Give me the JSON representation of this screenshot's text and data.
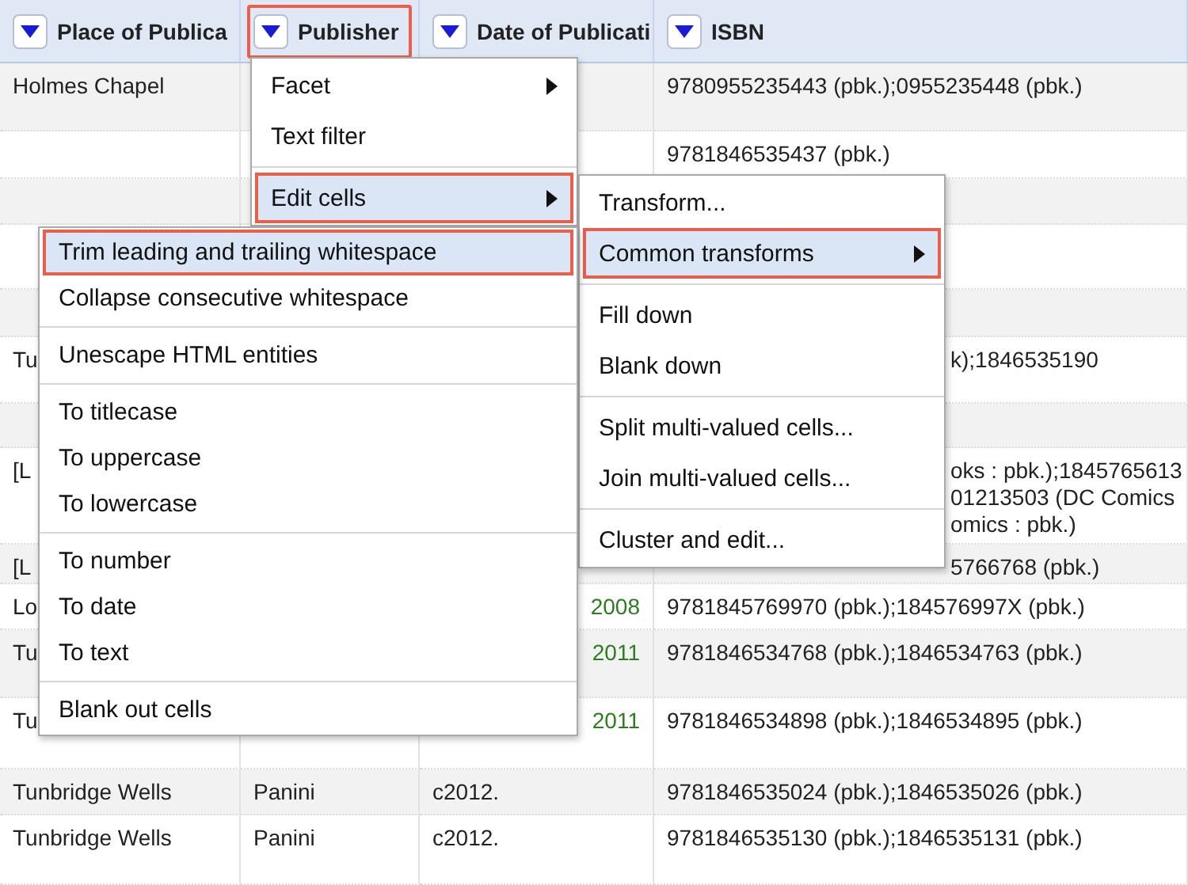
{
  "columns": [
    {
      "label": "Place of Publica",
      "outlined": false
    },
    {
      "label": "Publisher",
      "outlined": true
    },
    {
      "label": "Date of Publicati",
      "outlined": false
    },
    {
      "label": "ISBN",
      "outlined": false
    }
  ],
  "rows": [
    {
      "place": {
        "kind": "text",
        "text": "Holmes Chapel"
      },
      "isbn": {
        "kind": "text",
        "text": "9780955235443 (pbk.);0955235448 (pbk.)"
      }
    },
    {
      "isbn": {
        "kind": "text",
        "text": "9781846535437 (pbk.)"
      }
    },
    {},
    {},
    {},
    {
      "place": {
        "kind": "text",
        "text": "Tu"
      },
      "isbn": {
        "kind": "clipped",
        "text": "k);1846535190"
      }
    },
    {},
    {
      "place": {
        "kind": "text",
        "text": "[L"
      },
      "isbn": {
        "kind": "clipped",
        "text": "oks : pbk.);1845765613\n01213503 (DC Comics\nomics : pbk.)"
      }
    },
    {
      "place": {
        "kind": "text",
        "text": "[L"
      },
      "isbn": {
        "kind": "clipped",
        "text": "5766768 (pbk.)"
      }
    },
    {
      "place": {
        "kind": "text",
        "text": "Lo"
      },
      "date": {
        "kind": "number",
        "text": "2008"
      },
      "isbn": {
        "kind": "text",
        "text": "9781845769970 (pbk.);184576997X (pbk.)"
      }
    },
    {
      "place": {
        "kind": "text",
        "text": "Tu"
      },
      "date": {
        "kind": "number",
        "text": "2011"
      },
      "isbn": {
        "kind": "text",
        "text": "9781846534768 (pbk.);1846534763 (pbk.)"
      }
    },
    {
      "place": {
        "kind": "text",
        "text": "Tu"
      },
      "date": {
        "kind": "number",
        "text": "2011"
      },
      "isbn": {
        "kind": "text",
        "text": "9781846534898 (pbk.);1846534895 (pbk.)"
      }
    },
    {
      "place": {
        "kind": "text",
        "text": "Tunbridge Wells"
      },
      "publisher": {
        "kind": "text",
        "text": "Panini"
      },
      "date": {
        "kind": "text",
        "text": "c2012."
      },
      "isbn": {
        "kind": "text",
        "text": "9781846535024 (pbk.);1846535026 (pbk.)"
      }
    },
    {
      "place": {
        "kind": "text",
        "text": "Tunbridge Wells"
      },
      "publisher": {
        "kind": "text",
        "text": "Panini"
      },
      "date": {
        "kind": "text",
        "text": "c2012."
      },
      "isbn": {
        "kind": "text",
        "text": "9781846535130 (pbk.);1846535131 (pbk.)"
      }
    }
  ],
  "menus": [
    {
      "items": [
        {
          "kind": "item",
          "label": "Facet",
          "submenu": true,
          "selected": false,
          "outlined": false
        },
        {
          "kind": "item",
          "label": "Text filter",
          "submenu": false,
          "selected": false,
          "outlined": false
        },
        {
          "kind": "separator"
        },
        {
          "kind": "item",
          "label": "Edit cells",
          "submenu": true,
          "selected": true,
          "outlined": true
        }
      ]
    },
    {
      "items": [
        {
          "kind": "item",
          "label": "Transform...",
          "submenu": false,
          "selected": false,
          "outlined": false
        },
        {
          "kind": "item",
          "label": "Common transforms",
          "submenu": true,
          "selected": true,
          "outlined": true
        },
        {
          "kind": "separator"
        },
        {
          "kind": "item",
          "label": "Fill down",
          "submenu": false,
          "selected": false,
          "outlined": false
        },
        {
          "kind": "item",
          "label": "Blank down",
          "submenu": false,
          "selected": false,
          "outlined": false
        },
        {
          "kind": "separator"
        },
        {
          "kind": "item",
          "label": "Split multi-valued cells...",
          "submenu": false,
          "selected": false,
          "outlined": false
        },
        {
          "kind": "item",
          "label": "Join multi-valued cells...",
          "submenu": false,
          "selected": false,
          "outlined": false
        },
        {
          "kind": "separator"
        },
        {
          "kind": "item",
          "label": "Cluster and edit...",
          "submenu": false,
          "selected": false,
          "outlined": false
        }
      ]
    },
    {
      "items": [
        {
          "kind": "item",
          "label": "Trim leading and trailing whitespace",
          "submenu": false,
          "selected": true,
          "outlined": true
        },
        {
          "kind": "item",
          "label": "Collapse consecutive whitespace",
          "submenu": false,
          "selected": false,
          "outlined": false
        },
        {
          "kind": "separator"
        },
        {
          "kind": "item",
          "label": "Unescape HTML entities",
          "submenu": false,
          "selected": false,
          "outlined": false
        },
        {
          "kind": "separator"
        },
        {
          "kind": "item",
          "label": "To titlecase",
          "submenu": false,
          "selected": false,
          "outlined": false
        },
        {
          "kind": "item",
          "label": "To uppercase",
          "submenu": false,
          "selected": false,
          "outlined": false
        },
        {
          "kind": "item",
          "label": "To lowercase",
          "submenu": false,
          "selected": false,
          "outlined": false
        },
        {
          "kind": "separator"
        },
        {
          "kind": "item",
          "label": "To number",
          "submenu": false,
          "selected": false,
          "outlined": false
        },
        {
          "kind": "item",
          "label": "To date",
          "submenu": false,
          "selected": false,
          "outlined": false
        },
        {
          "kind": "item",
          "label": "To text",
          "submenu": false,
          "selected": false,
          "outlined": false
        },
        {
          "kind": "separator"
        },
        {
          "kind": "item",
          "label": "Blank out cells",
          "submenu": false,
          "selected": false,
          "outlined": false
        }
      ]
    }
  ]
}
